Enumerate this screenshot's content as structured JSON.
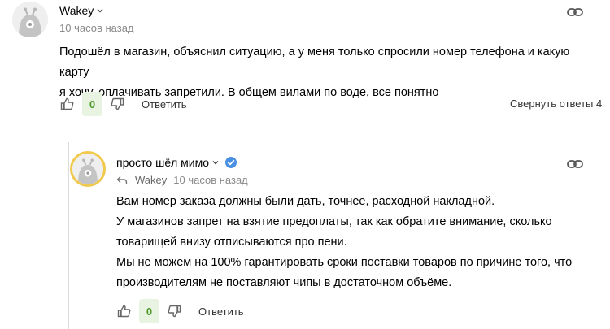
{
  "comments": [
    {
      "author": "Wakey",
      "time": "10 часов назад",
      "lines": [
        "Подошёл в магазин, объяснил ситуацию, а у меня только спросили номер телефона и какую карту",
        "я хочу, оплачивать запретили. В общем вилами по воде, все понятно"
      ],
      "score": "0",
      "reply_label": "Ответить",
      "collapse_label": "Свернуть ответы 4"
    },
    {
      "author": "просто шёл мимо",
      "reply_to_author": "Wakey",
      "time": "10 часов назад",
      "lines": [
        "Вам номер заказа должны были дать, точнее, расходной накладной.",
        "У магазинов запрет на взятие предоплаты, так как обратите внимание, сколько",
        "товарищей внизу отписываются про пени.",
        "Мы не можем на 100% гарантировать сроки поставки товаров по причине того, что",
        "производителям не поставляют чипы в достаточном объёме."
      ],
      "score": "0",
      "reply_label": "Ответить"
    }
  ],
  "colors": {
    "score_bg": "#e8f4e1",
    "score_text": "#4c9a2a",
    "verified": "#4a90e2",
    "avatar_ring": "#f1c94f"
  }
}
